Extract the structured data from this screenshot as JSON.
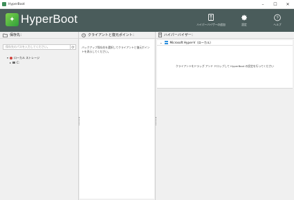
{
  "window": {
    "title": "HyperBoot"
  },
  "header": {
    "brand": "HyperBoot"
  },
  "toolbar": {
    "items": [
      {
        "label": "ハイパーバイザーの追加",
        "icon": "device-icon"
      },
      {
        "label": "設定",
        "icon": "gear-icon"
      },
      {
        "label": "ヘルプ",
        "icon": "help-icon"
      }
    ]
  },
  "panes": {
    "left": {
      "title": "保存先：",
      "search_placeholder": "保存先のパスを入力してください。",
      "tree": [
        {
          "label": "ローカル ストレージ",
          "expanded": true
        },
        {
          "label": "C:",
          "expanded": false
        }
      ]
    },
    "middle": {
      "title": "クライアントと復元ポイント：",
      "hint": "バックアップ保存先を選択してクライアントと復元ポイントを表示してください。"
    },
    "right": {
      "title": "ハイパーバイザー：",
      "hypervisor": "Microsoft Hyper-V（ローカル）",
      "drop_hint": "クライアントをドラッグ アンド ドロップして HyperBoot の設定を行ってください"
    }
  },
  "colors": {
    "header_bg": "#4a5c5b",
    "accent_green": "#2f9f3b",
    "windows_blue": "#2d8fdc"
  }
}
